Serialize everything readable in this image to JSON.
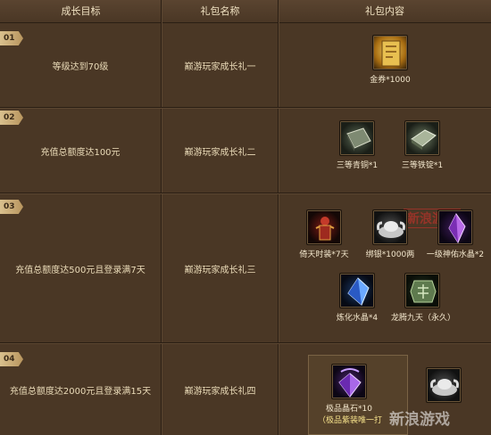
{
  "header": {
    "col1": "成长目标",
    "col2": "礼包名称",
    "col3": "礼包内容"
  },
  "rows": [
    {
      "num": "01",
      "goal": "等级达到70级",
      "name": "巅游玩家成长礼一",
      "items": [
        {
          "label": "金券*1000",
          "icon": "gold-ticket-icon"
        }
      ]
    },
    {
      "num": "02",
      "goal": "充值总额度达100元",
      "name": "巅游玩家成长礼二",
      "items": [
        {
          "label": "三等青铜*1",
          "icon": "bronze-ingot-icon"
        },
        {
          "label": "三等铁锭*1",
          "icon": "iron-ingot-icon"
        }
      ]
    },
    {
      "num": "03",
      "goal": "充值总额度达500元且登录满7天",
      "name": "巅游玩家成长礼三",
      "items": [
        {
          "label": "倚天时装*7天",
          "icon": "armor-costume-icon"
        },
        {
          "label": "绑银*1000两",
          "icon": "silver-ingot-icon"
        },
        {
          "label": "一级神佑水晶*2",
          "icon": "purple-crystal-icon"
        },
        {
          "label": "炼化水晶*4",
          "icon": "blue-crystal-icon"
        },
        {
          "label": "龙腾九天（永久）",
          "icon": "dragon-token-icon"
        }
      ]
    },
    {
      "num": "04",
      "goal": "充值总额度达2000元且登录满15天",
      "name": "巅游玩家成长礼四",
      "items": [
        {
          "label": "极品晶石*10",
          "sublabel": "（极品紫装唯一打",
          "icon": "premium-gem-icon"
        },
        {
          "label": "",
          "icon": "silver-ingot-icon"
        }
      ]
    }
  ],
  "watermark": "新浪游戏",
  "stamp": "新浪游戏",
  "colors": {
    "tab": "#d9c08e",
    "bg": "#4a3725",
    "text": "#eadbb8"
  }
}
